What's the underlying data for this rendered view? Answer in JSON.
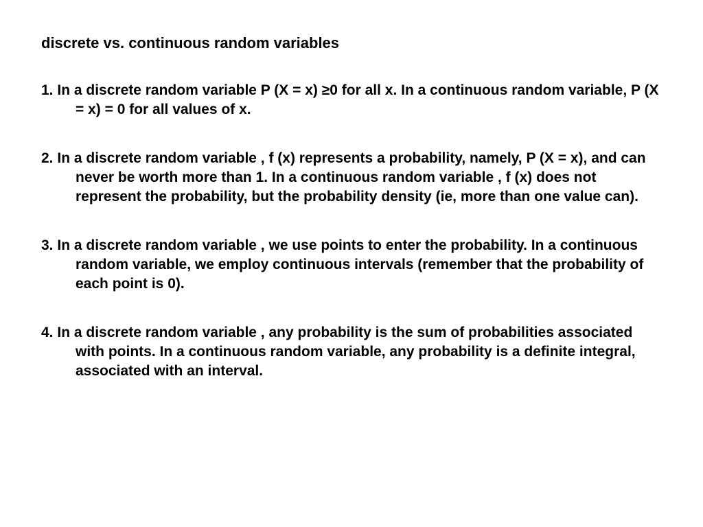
{
  "title": "discrete vs. continuous random variables",
  "points": [
    {
      "num": "1.",
      "text": "In a discrete random variable P (X = x) ≥0 for all x. In a continuous random variable, P (X = x) = 0 for all values of x."
    },
    {
      "num": "2.",
      "text": "In a discrete random variable , f (x) represents a probability, namely, P (X = x), and can never be worth more than 1. In a continuous random variable , f (x) does not represent the probability, but the probability density (ie, more than one value can)."
    },
    {
      "num": "3.",
      "text": "In a discrete random variable , we use points to enter the probability. In a continuous random variable, we employ continuous intervals (remember that the probability of each point is 0)."
    },
    {
      "num": "4.",
      "text": "In a discrete random variable , any probability is the sum of probabilities associated with points. In a continuous random variable, any probability is a definite integral, associated with an interval."
    }
  ]
}
